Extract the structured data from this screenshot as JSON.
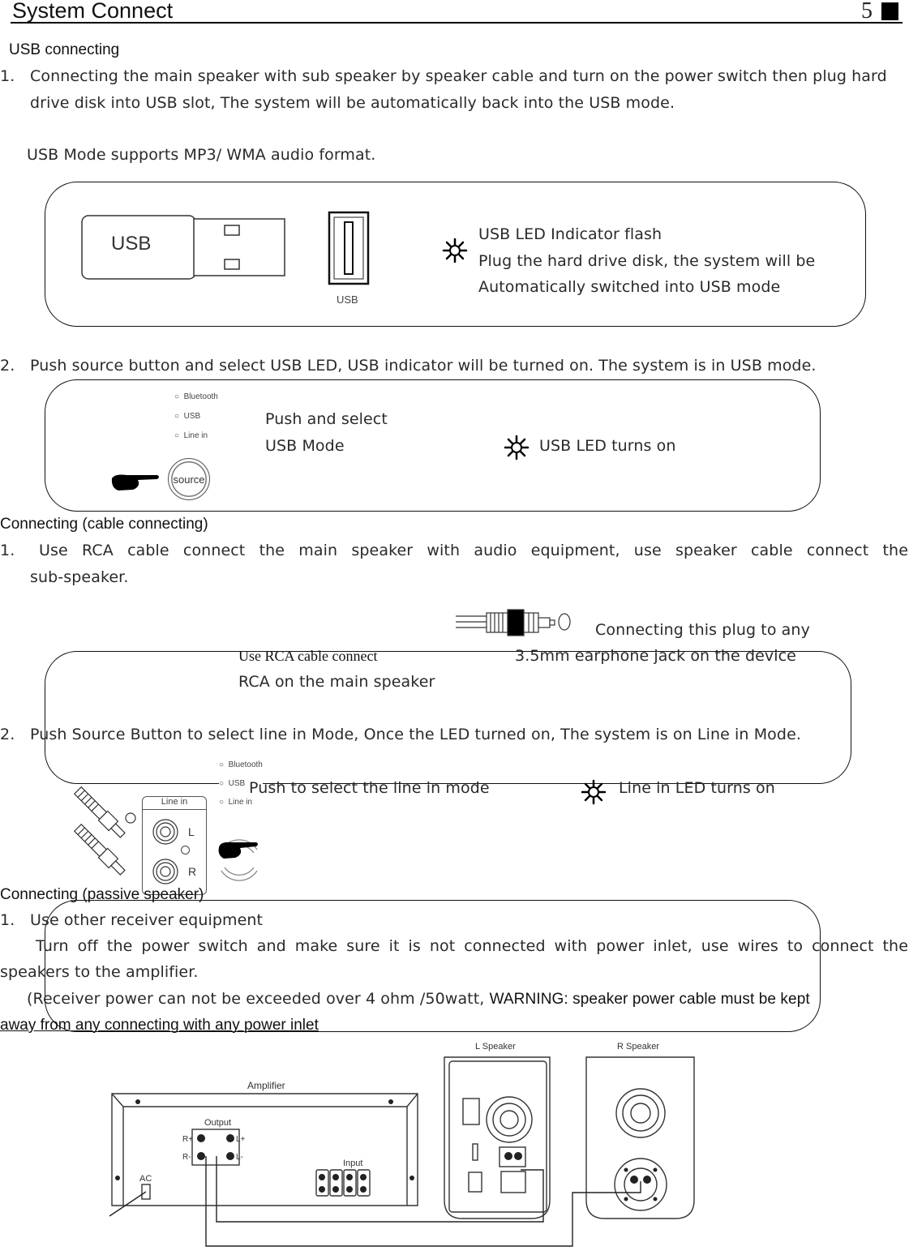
{
  "header": {
    "title": "System Connect",
    "page_number": "5"
  },
  "usb_section": {
    "heading": "USB connecting",
    "step1_number": "1.",
    "step1_line1": "Connecting the main speaker with sub speaker by speaker cable and turn on the power switch then plug hard",
    "step1_line2": "drive disk into USB slot, The system will be automatically back into the USB mode.",
    "formats_note": "USB Mode supports MP3/ WMA audio format.",
    "figure1": {
      "usb_stick_label": "USB",
      "usb_port_label": "USB",
      "led_icon": "led-flash-icon",
      "note_line1": "USB LED Indicator flash",
      "note_line2": "Plug the hard drive disk, the system will be",
      "note_line3": "Automatically switched into USB mode"
    },
    "step2_number": "2.",
    "step2_text": "Push source button and select USB LED, USB indicator will be turned on. The system is in USB mode.",
    "figure2": {
      "indicators": [
        "Bluetooth",
        "USB",
        "Line in"
      ],
      "source_button_label": "source",
      "push_line1": "Push and select",
      "push_line2": "USB Mode",
      "led_note": "USB LED turns on"
    }
  },
  "cable_section": {
    "heading": "Connecting (cable connecting)",
    "step1_number": "1.",
    "step1_line1": "Use RCA cable connect the main speaker with audio equipment, use speaker cable connect the",
    "step1_line2": "sub-speaker.",
    "plug_note_line1": "Connecting this plug to any",
    "plug_note_line2": "3.5mm earphone jack on the device",
    "rca_note_line1": "Use RCA cable connect",
    "rca_note_line2": "RCA on the main speaker",
    "step2_number": "2.",
    "step2_text": "Push Source Button to select line in Mode, Once the LED turned on, The system is on Line in Mode.",
    "figure": {
      "indicators": [
        "Bluetooth",
        "USB",
        "Line in"
      ],
      "panel_label": "Line in",
      "left_label": "L",
      "right_label": "R",
      "push_note": "Push to select the line in mode",
      "led_note": "Line in LED turns on"
    }
  },
  "passive_section": {
    "heading": "Connecting  (passive speaker)",
    "step1_number": "1.",
    "step1_title": "Use other receiver equipment",
    "para_line1": "Turn off the power switch and make sure it is not connected with power inlet, use wires to connect the",
    "para_line2": "speakers to the amplifier.",
    "note_prefix": "(Receiver power can not be exceeded over 4 ohm /50watt,",
    "warning_line1": "WARNING: speaker power cable must be kept",
    "warning_line2": "away from any connecting with any power inlet"
  },
  "diagram": {
    "amplifier_label": "Amplifier",
    "output_label": "Output",
    "terminal_labels": [
      "R+",
      "R-",
      "L+",
      "L-"
    ],
    "input_label": "Input",
    "ac_label": "AC",
    "left_speaker_label": "L Speaker",
    "right_speaker_label": "R Speaker"
  }
}
